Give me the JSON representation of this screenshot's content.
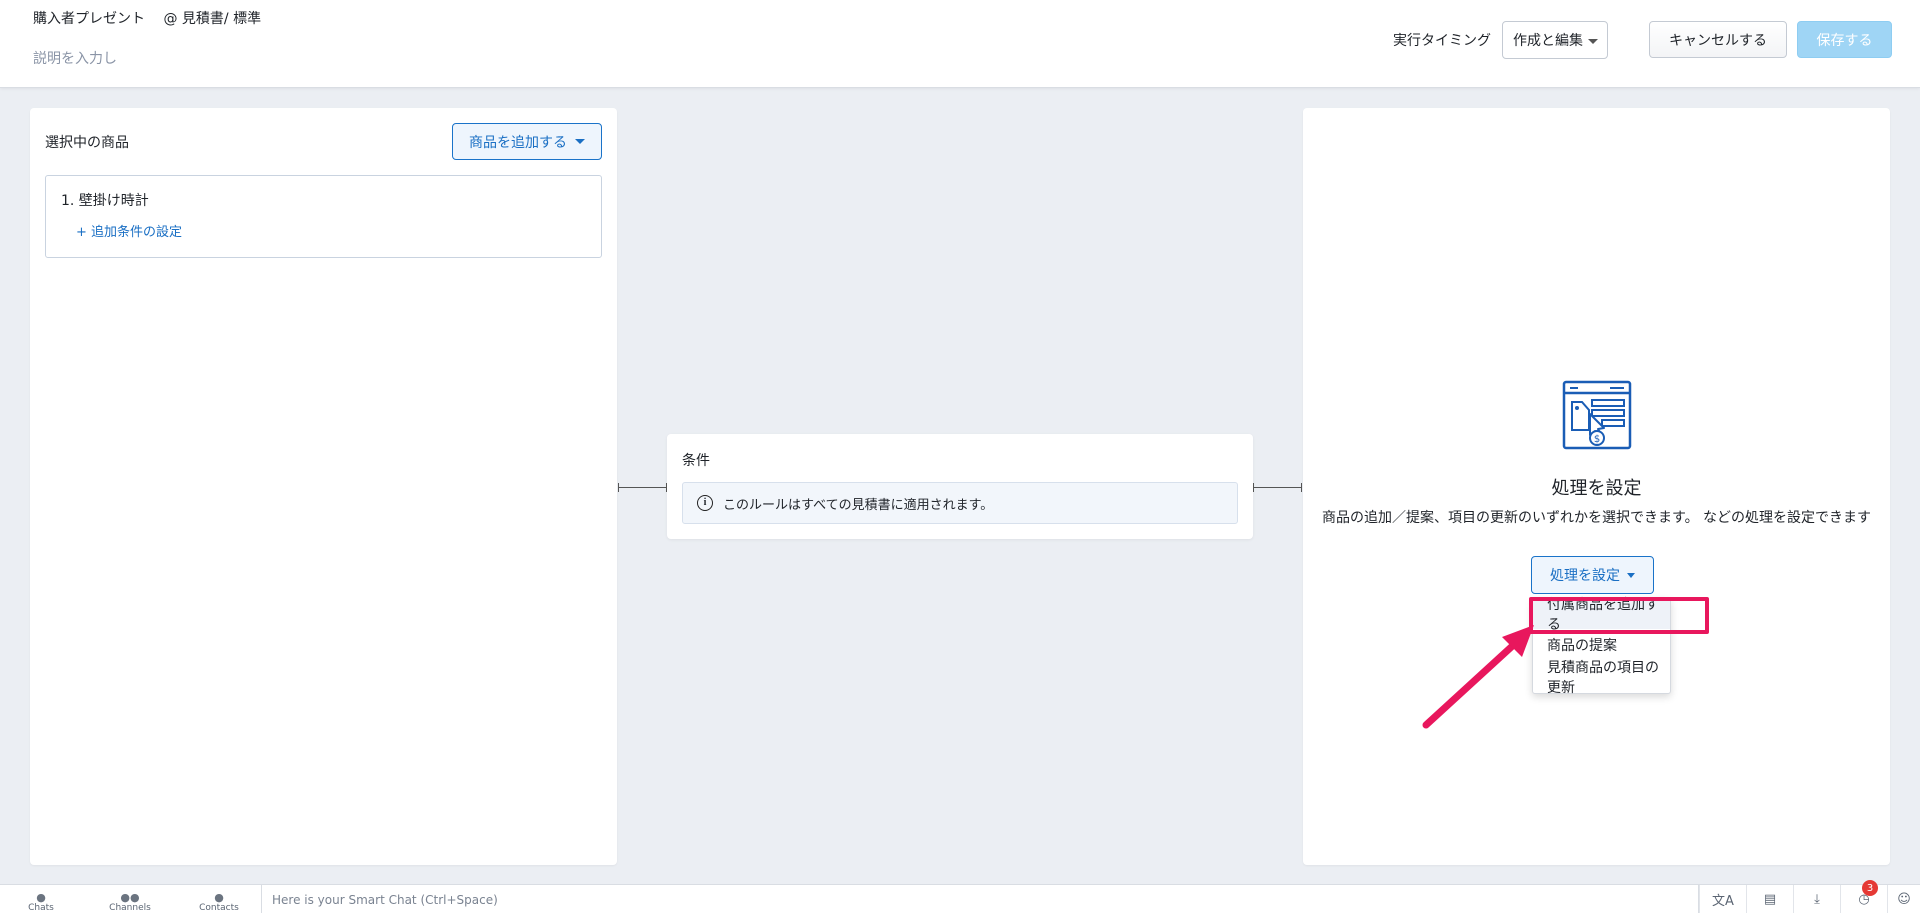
{
  "header": {
    "rule_name": "購入者プレゼント",
    "rule_scope": "@ 見積書/ 標準",
    "description_placeholder": "説明を入力し",
    "timing_label": "実行タイミング",
    "timing_value": "作成と編集",
    "cancel_label": "キャンセルする",
    "save_label": "保存する"
  },
  "left_panel": {
    "title": "選択中の商品",
    "add_product_label": "商品を追加する",
    "products": [
      {
        "name": "1. 壁掛け時計",
        "add_condition_label": "+ 追加条件の設定"
      }
    ]
  },
  "condition": {
    "title": "条件",
    "info_text": "このルールはすべての見積書に適用されます。"
  },
  "right_panel": {
    "title": "処理を設定",
    "description": "商品の追加／提案、項目の更新のいずれかを選択できます。 などの処理を設定できます",
    "action_button_label": "処理を設定",
    "dropdown_items": [
      "付属商品を追加する",
      "商品の提案",
      "見積商品の項目の更新"
    ],
    "highlighted_item": "付属商品を追加する"
  },
  "bottombar": {
    "tabs": [
      {
        "label": "Chats",
        "icon": "chat-bubble-icon"
      },
      {
        "label": "Channels",
        "icon": "group-icon"
      },
      {
        "label": "Contacts",
        "icon": "person-icon"
      }
    ],
    "smartchat_placeholder": "Here is your Smart Chat (Ctrl+Space)",
    "notification_count": "3"
  },
  "colors": {
    "accent": "#1a6fc4",
    "highlight": "#e8175d",
    "background": "#ebeef3",
    "save_disabled": "#9fd5f5"
  }
}
